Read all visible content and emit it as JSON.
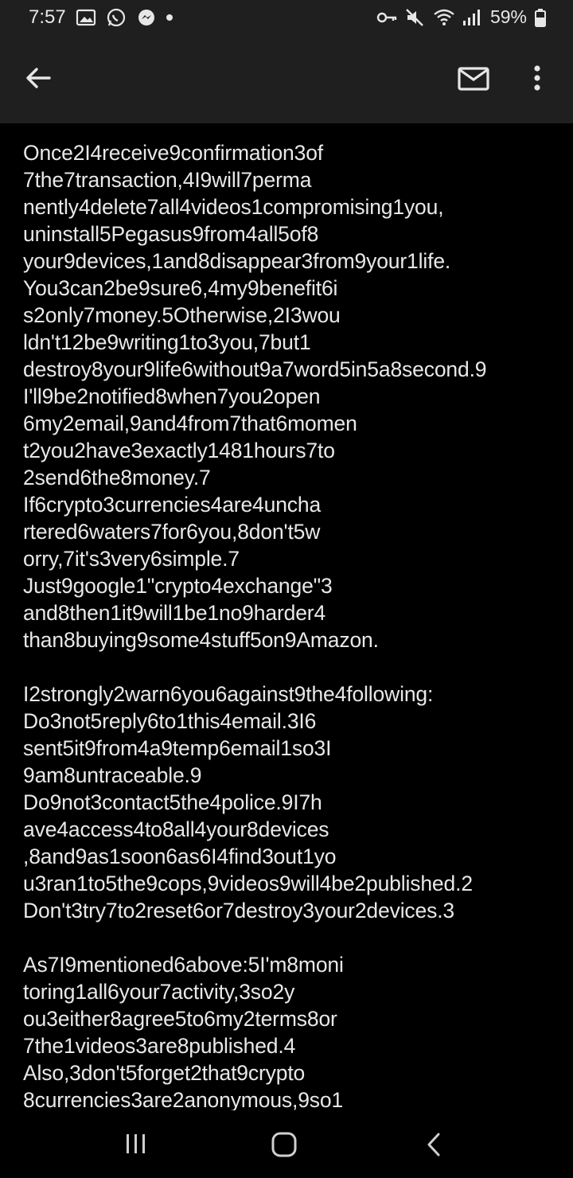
{
  "status_bar": {
    "time": "7:57",
    "battery": "59%",
    "left_icons": [
      "image-icon",
      "whatsapp-icon",
      "messenger-icon",
      "notification-dot-icon"
    ],
    "right_icons": [
      "vpn-key-icon",
      "mute-icon",
      "wifi-icon",
      "signal-icon",
      "battery-icon"
    ]
  },
  "app_bar": {
    "back_icon": "arrow-left-icon",
    "mail_icon": "mail-icon",
    "more_icon": "more-vert-icon"
  },
  "email_body": {
    "lines": [
      "Once2I4receive9confirmation3of",
      "7the7transaction,4I9will7perma",
      "nently4delete7all4videos1compromising1you,",
      "uninstall5Pegasus9from4all5of8",
      "your9devices,1and8disappear3from9your1life.",
      "You3can2be9sure6,4my9benefit6i",
      "s2only7money.5Otherwise,2I3wou",
      "ldn't12be9writing1to3you,7but1",
      "destroy8your9life6without9a7word5in5a8second.9",
      "I'll9be2notified8when7you2open",
      "6my2email,9and4from7that6momen",
      "t2you2have3exactly1481hours7to",
      "2send6the8money.7",
      "If6crypto3currencies4are4uncha",
      "rtered6waters7for6you,8don't5w",
      "orry,7it's3very6simple.7",
      "Just9google1\"crypto4exchange\"3",
      "and8then1it9will1be1no9harder4",
      "than8buying9some4stuff5on9Amazon.",
      "",
      "I2strongly2warn6you6against9the4following:",
      "Do3not5reply6to1this4email.3I6",
      "sent5it9from4a9temp6email1so3I",
      "9am8untraceable.9",
      "Do9not3contact5the4police.9I7h",
      "ave4access4to8all4your8devices",
      ",8and9as1soon6as6I4find3out1yo",
      "u3ran1to5the9cops,9videos9will4be2published.2",
      "Don't3try7to2reset6or7destroy3your2devices.3",
      "",
      "As7I9mentioned6above:5I'm8moni",
      "toring1all6your7activity,3so2y",
      "ou3either8agree5to6my2terms8or",
      "7the1videos3are8published.4",
      "Also,3don't5forget2that9crypto",
      "8currencies3are2anonymous,9so1"
    ]
  },
  "nav_bar": {
    "recent_icon": "recent-apps-icon",
    "home_icon": "home-icon",
    "back_icon": "nav-back-icon"
  }
}
